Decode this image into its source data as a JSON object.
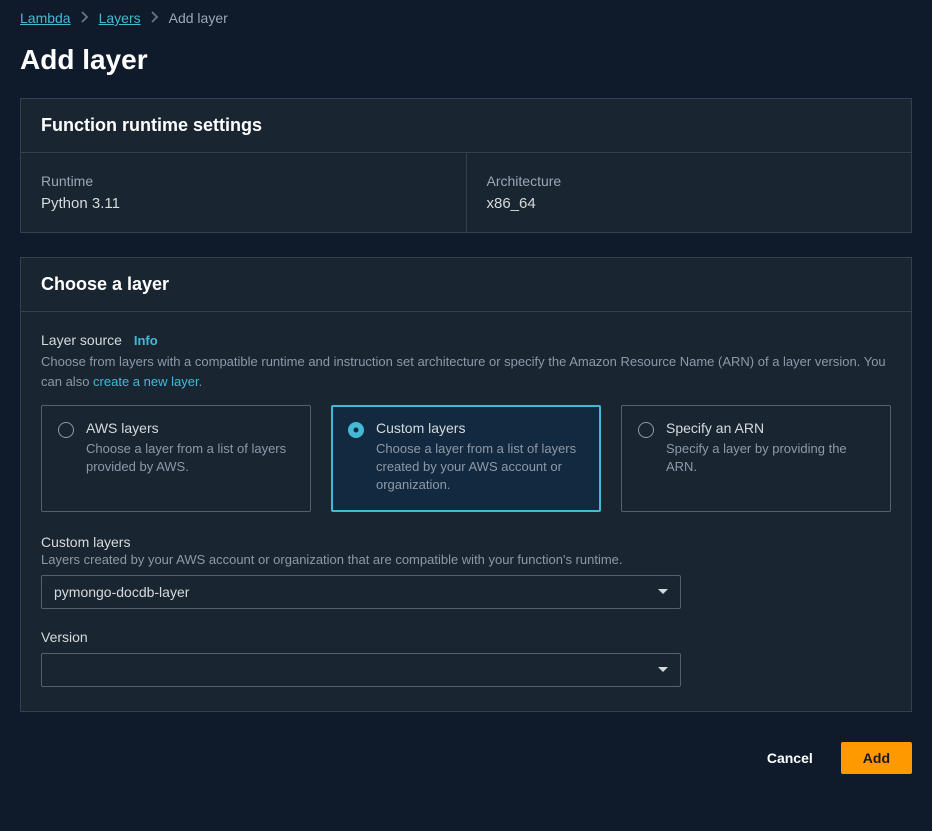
{
  "breadcrumb": {
    "items": [
      "Lambda",
      "Layers"
    ],
    "current": "Add layer"
  },
  "page_title": "Add layer",
  "runtime_panel": {
    "title": "Function runtime settings",
    "runtime_label": "Runtime",
    "runtime_value": "Python 3.11",
    "arch_label": "Architecture",
    "arch_value": "x86_64"
  },
  "choose_panel": {
    "title": "Choose a layer",
    "source_label": "Layer source",
    "info_label": "Info",
    "source_help_prefix": "Choose from layers with a compatible runtime and instruction set architecture or specify the Amazon Resource Name (ARN) of a layer version. You can also ",
    "source_help_link": "create a new layer",
    "source_help_suffix": ".",
    "options": [
      {
        "title": "AWS layers",
        "desc": "Choose a layer from a list of layers provided by AWS."
      },
      {
        "title": "Custom layers",
        "desc": "Choose a layer from a list of layers created by your AWS account or organization."
      },
      {
        "title": "Specify an ARN",
        "desc": "Specify a layer by providing the ARN."
      }
    ],
    "selected_index": 1,
    "custom_label": "Custom layers",
    "custom_help": "Layers created by your AWS account or organization that are compatible with your function's runtime.",
    "custom_selected": "pymongo-docdb-layer",
    "version_label": "Version",
    "version_selected": ""
  },
  "actions": {
    "cancel": "Cancel",
    "add": "Add"
  }
}
